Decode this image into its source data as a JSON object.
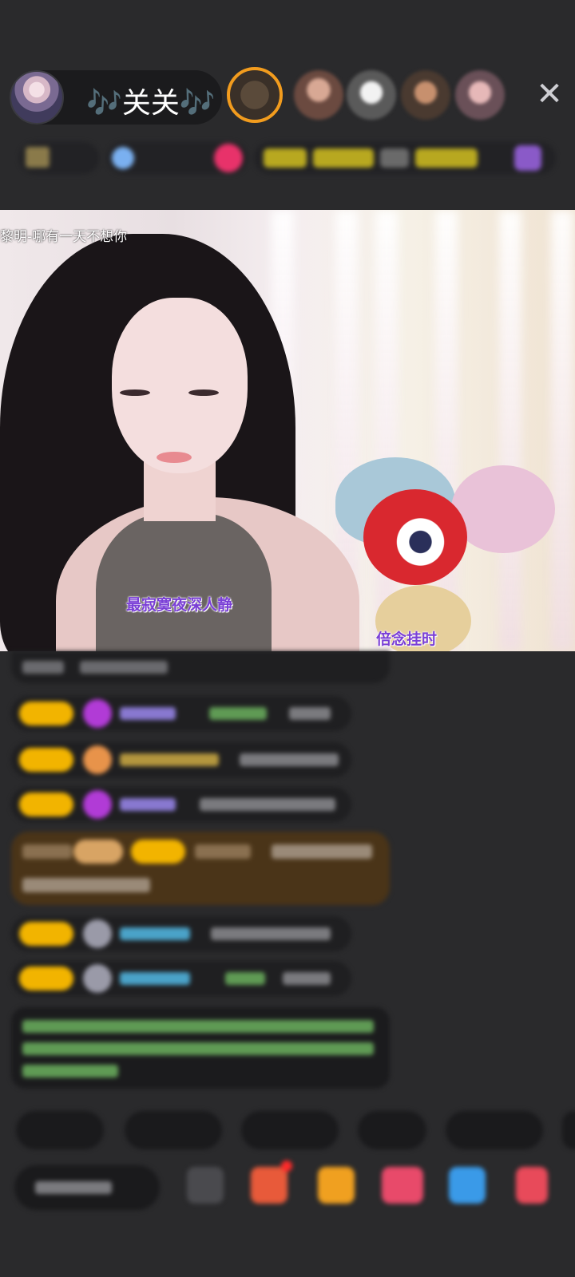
{
  "header": {
    "host_name": "🎶关关🎶",
    "close_icon": "close-icon"
  },
  "video": {
    "song_tag": "黎明-哪有一天不想你",
    "lyric_left": "最寂寞夜深人静",
    "lyric_right": "倍念挂时"
  },
  "chat": {
    "messages": [
      {
        "badge": "",
        "user": "",
        "text": ""
      },
      {
        "badge": "",
        "user": "",
        "text": ""
      },
      {
        "badge": "",
        "user": "",
        "text": ""
      },
      {
        "badge": "",
        "user": "",
        "text": ""
      }
    ]
  },
  "bottom": {
    "chips": [
      "",
      "",
      "",
      "",
      ""
    ],
    "input_placeholder": ""
  },
  "colors": {
    "background": "#2a2a2c",
    "badge": "#f2b400",
    "highlight_message": "#4a3418",
    "viewer_ring": "#f29c1e"
  }
}
